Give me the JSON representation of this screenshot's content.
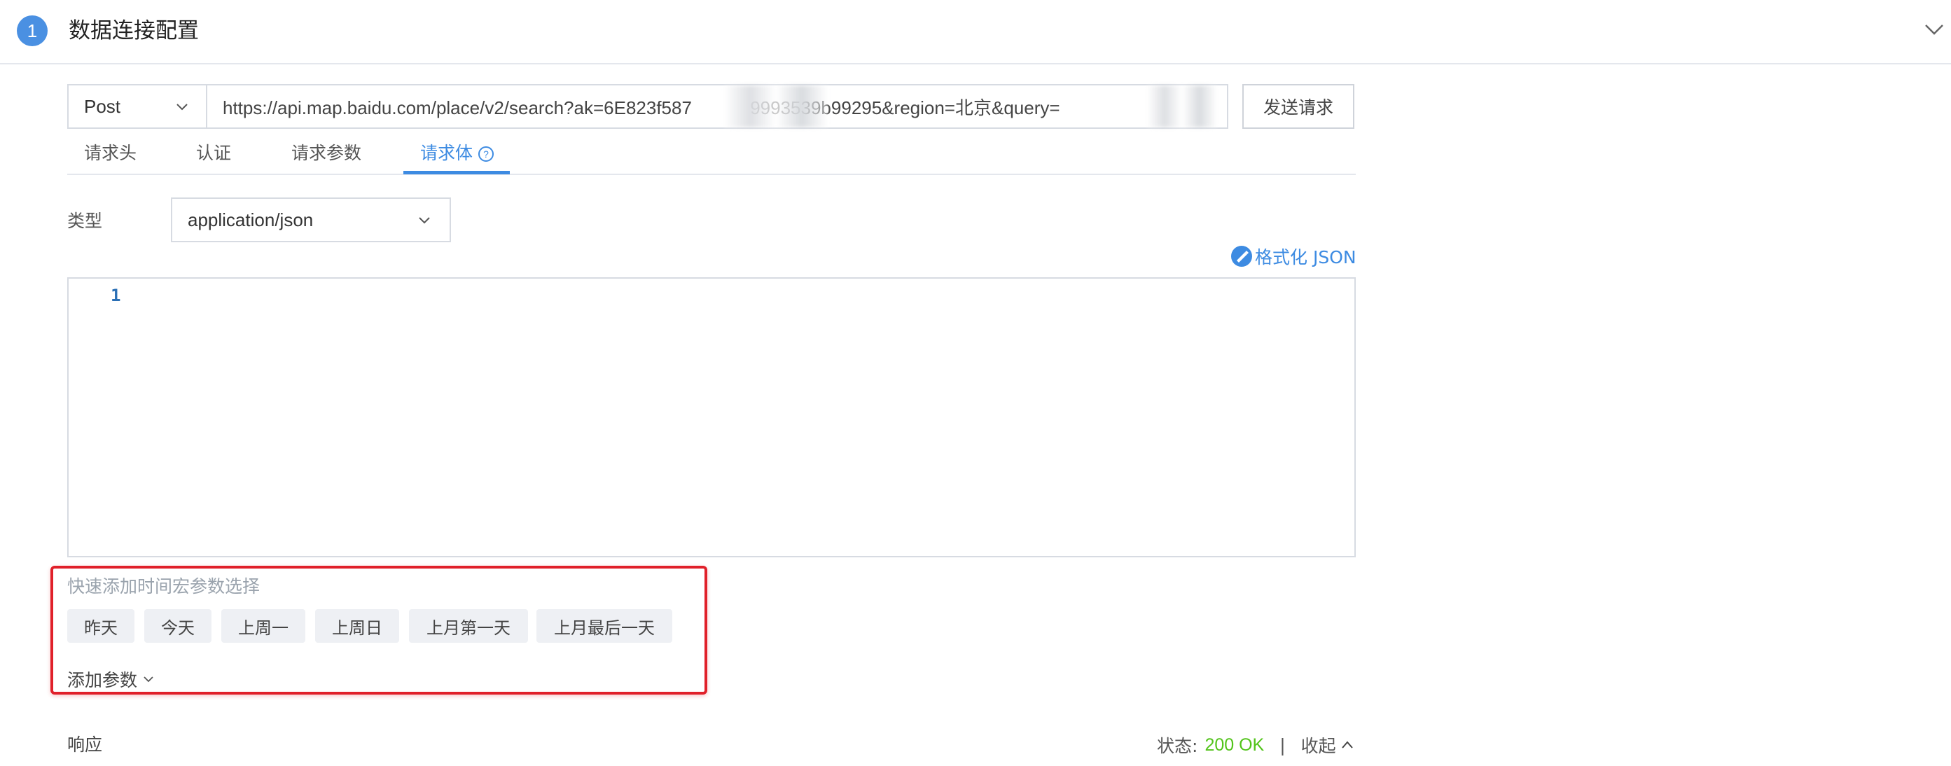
{
  "section": {
    "step": "1",
    "title": "数据连接配置"
  },
  "request": {
    "method": "Post",
    "url": "https://api.map.baidu.com/place/v2/search?ak=6E823f587                9993539b99295&region=北京&query=",
    "send_label": "发送请求"
  },
  "tabs": [
    {
      "label": "请求头"
    },
    {
      "label": "认证"
    },
    {
      "label": "请求参数"
    },
    {
      "label": "请求体",
      "active": true
    }
  ],
  "body": {
    "type_label": "类型",
    "type_value": "application/json",
    "format_label": "格式化 JSON",
    "line_number": "1"
  },
  "quick_macros": {
    "title": "快速添加时间宏参数选择",
    "chips": [
      "昨天",
      "今天",
      "上周一",
      "上周日",
      "上月第一天",
      "上月最后一天"
    ],
    "add_param_label": "添加参数"
  },
  "response": {
    "label": "响应",
    "status_label": "状态:",
    "status_value": "200 OK",
    "separator": "|",
    "collapse_label": "收起"
  },
  "colors": {
    "accent": "#3d8be2",
    "status_ok": "#52c41a",
    "highlight_border": "#e0202a"
  },
  "icons": [
    "chevron-down-icon",
    "help-circle-icon",
    "format-icon",
    "chevron-up-icon"
  ]
}
